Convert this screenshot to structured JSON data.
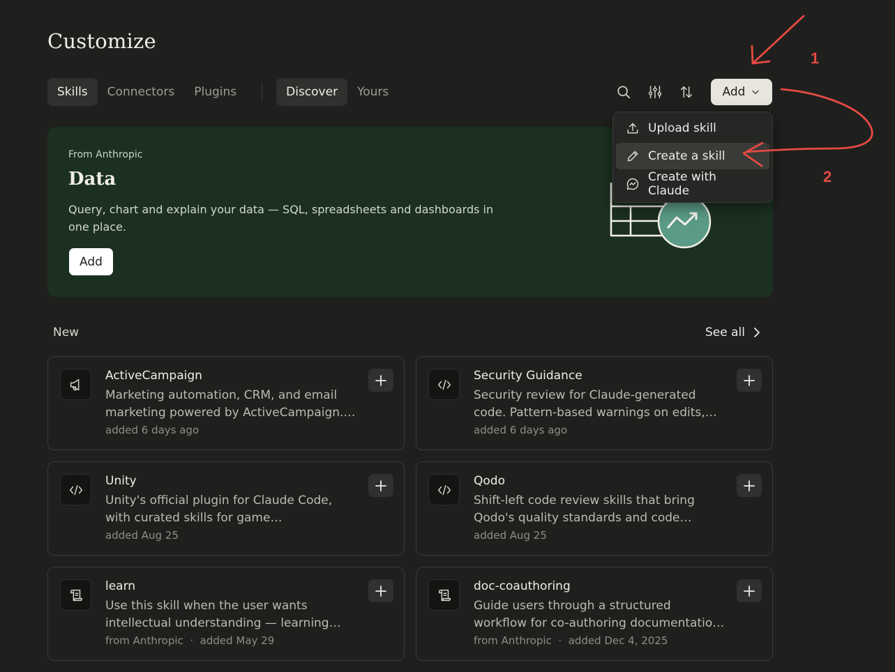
{
  "page": {
    "title": "Customize"
  },
  "tabs": {
    "primary": [
      "Skills",
      "Connectors",
      "Plugins"
    ],
    "secondary": [
      "Discover",
      "Yours"
    ]
  },
  "toolbar": {
    "add_label": "Add",
    "icons": [
      "search-icon",
      "filter-sliders-icon",
      "sort-arrows-icon",
      "chevron-down-icon"
    ]
  },
  "dropdown": {
    "items": [
      {
        "label": "Upload skill",
        "icon": "upload-icon"
      },
      {
        "label": "Create a skill",
        "icon": "pencil-icon"
      },
      {
        "label": "Create with Claude",
        "icon": "chat-bubble-icon"
      }
    ]
  },
  "hero": {
    "eyebrow": "From Anthropic",
    "title": "Data",
    "description": "Query, chart and explain your data — SQL, spreadsheets and dashboards in one place.",
    "add_label": "Add"
  },
  "section": {
    "label": "New",
    "see_all": "See all"
  },
  "cards": [
    {
      "title": "ActiveCampaign",
      "description": "Marketing automation, CRM, and email marketing powered by ActiveCampaign.…",
      "meta": "added 6 days ago",
      "icon": "megaphone-icon"
    },
    {
      "title": "Security Guidance",
      "description": "Security review for Claude-generated code. Pattern-based warnings on edits, LLM-…",
      "meta": "added 6 days ago",
      "icon": "code-icon"
    },
    {
      "title": "Unity",
      "description": "Unity's official plugin for Claude Code, with curated skills for game development,…",
      "meta": "added Aug 25",
      "icon": "code-icon"
    },
    {
      "title": "Qodo",
      "description": "Shift-left code review skills that bring Qodo's quality standards and code revie…",
      "meta": "added Aug 25",
      "icon": "code-icon"
    },
    {
      "title": "learn",
      "description": "Use this skill when the user wants intellectual understanding — learning ho…",
      "meta": "from Anthropic  ·  added May 29",
      "icon": "scroll-icon"
    },
    {
      "title": "doc-coauthoring",
      "description": "Guide users through a structured workflow for co-authoring documentation. Use wh…",
      "meta": "from Anthropic  ·  added Dec 4, 2025",
      "icon": "scroll-icon"
    }
  ],
  "annotations": {
    "one": "1",
    "two": "2",
    "color": "#e54b42"
  },
  "colors": {
    "background": "#1f1f1e",
    "hero": "#1b3020",
    "accent_red": "#e54b42"
  }
}
